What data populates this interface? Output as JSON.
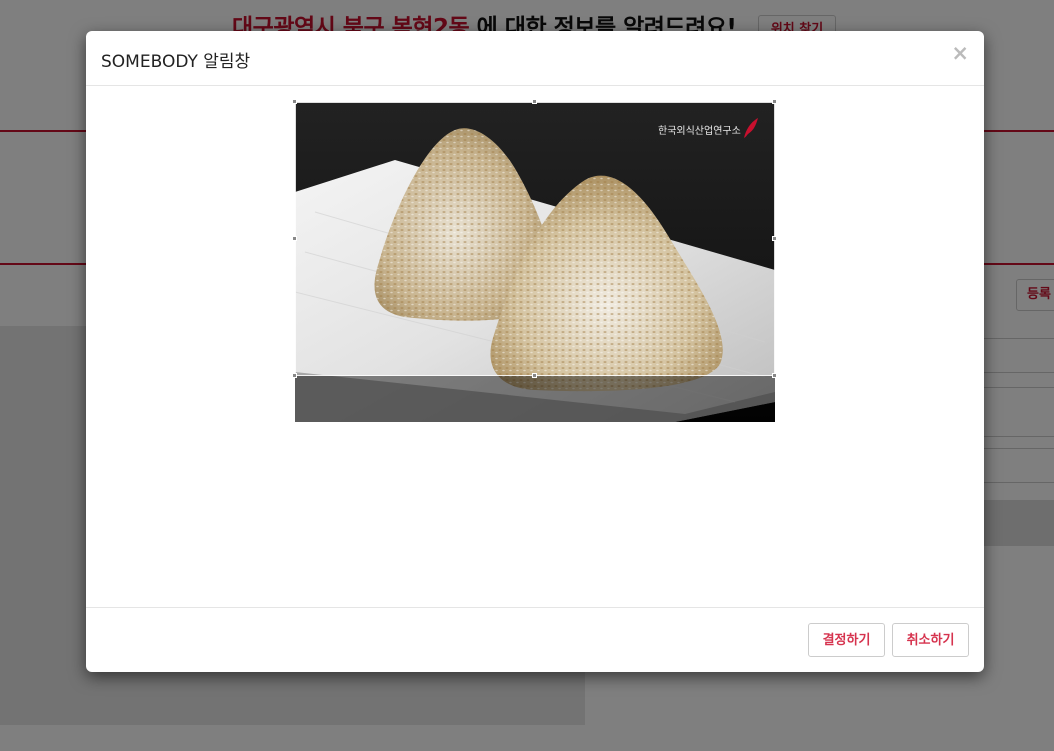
{
  "background": {
    "headline_highlight": "대구광역시 북구 복현2동",
    "headline_rest": " 에 대한 정보를 알려드려요!",
    "retry_button": "위치 찾기",
    "register_button": "등록"
  },
  "modal": {
    "title": "SOMEBODY 알림창",
    "close_symbol": "×",
    "image": {
      "watermark": "한국외식산업연구소",
      "description_icon": "photo-rice-balls",
      "brand_color": "#c8102e"
    },
    "footer": {
      "confirm_label": "결정하기",
      "cancel_label": "취소하기"
    }
  },
  "colors": {
    "accent": "#c8102e",
    "button_text": "#d6334e",
    "backdrop": "rgba(0,0,0,0.5)"
  }
}
